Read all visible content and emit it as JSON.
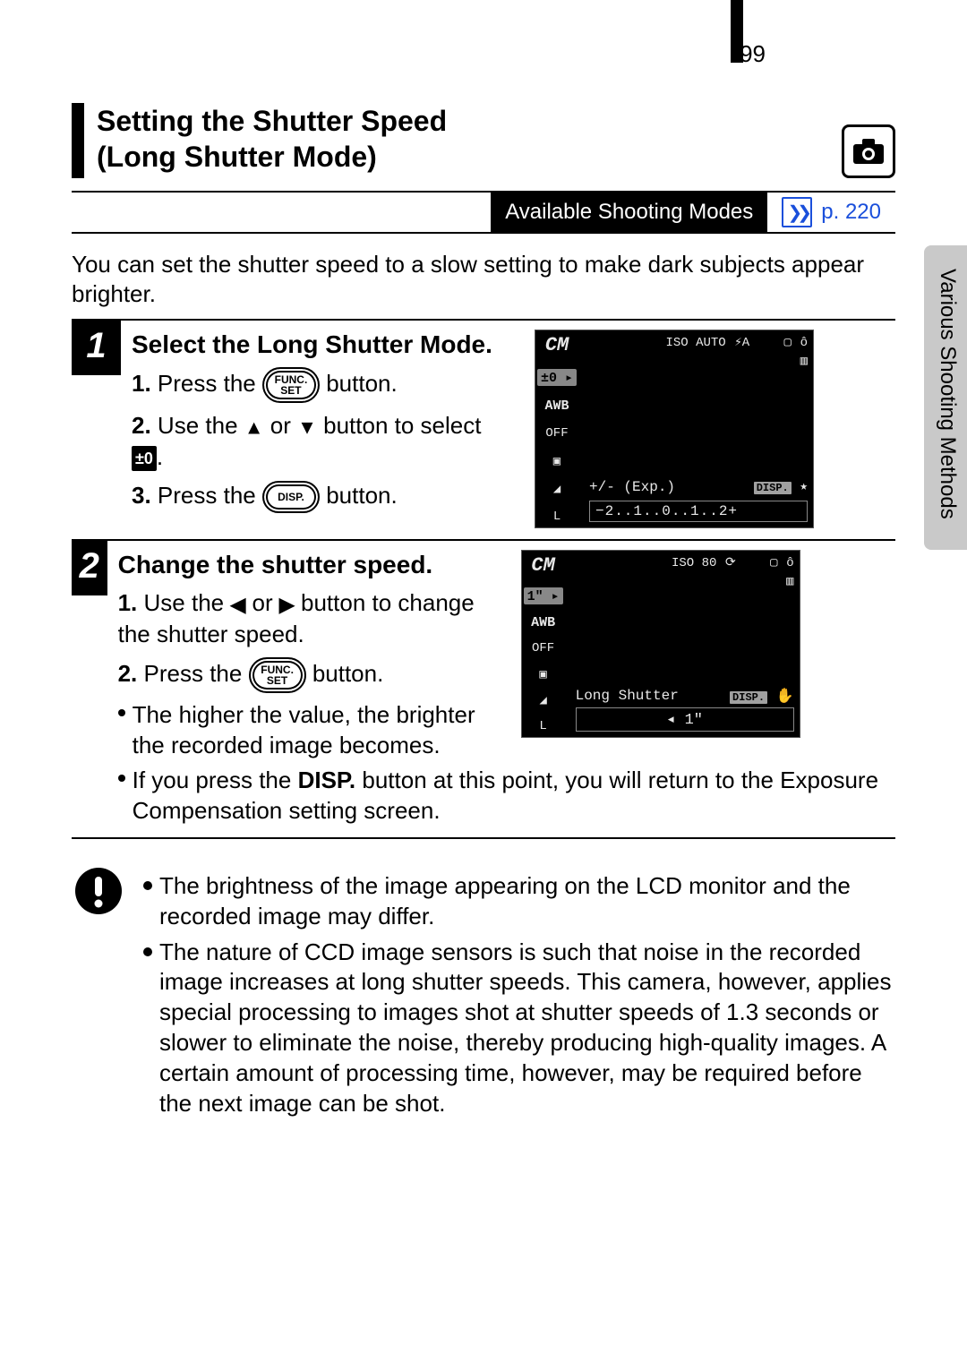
{
  "page_number": "99",
  "heading_line1": "Setting the Shutter Speed",
  "heading_line2": "(Long Shutter Mode)",
  "modes_label": "Available Shooting Modes",
  "modes_link": "p. 220",
  "intro_text": "You can set the shutter speed to a slow setting to make dark subjects appear brighter.",
  "side_label": "Various Shooting Methods",
  "step1": {
    "num": "1",
    "title": "Select the Long Shutter Mode.",
    "sub1_n": "1.",
    "sub1_a": "Press the ",
    "sub1_btn": "FUNC. SET",
    "sub1_b": " button.",
    "sub2_n": "2.",
    "sub2_a": "Use the ",
    "sub2_b": " or ",
    "sub2_c": " button to select ",
    "sub2_pm": "±0",
    "sub2_d": ".",
    "sub3_n": "3.",
    "sub3_a": "Press the ",
    "sub3_btn": "DISP.",
    "sub3_b": " button.",
    "lcd": {
      "cm": "CM",
      "pm": "±0 ▸",
      "awb": "AWB",
      "off": "OFF",
      "iso": "ISO AUTO",
      "flash": "⚡A",
      "frame": "▢",
      "timer": "ô",
      "batt": "▥",
      "L": "L",
      "exp_label": "+/- (Exp.)",
      "disp": "DISP.",
      "star": "⭑",
      "scale": "−2..1..0..1..2+"
    }
  },
  "step2": {
    "num": "2",
    "title": "Change the shutter speed.",
    "sub1_n": "1.",
    "sub1_a": "Use the ",
    "sub1_b": " or ",
    "sub1_c": " button to change the shutter speed.",
    "sub2_n": "2.",
    "sub2_a": "Press the ",
    "sub2_btn": "FUNC. SET",
    "sub2_b": " button.",
    "bullet1": "The higher the value, the brighter the recorded image becomes.",
    "bullet2a": "If you press the ",
    "bullet2b": "DISP.",
    "bullet2c": " button at this point, you will return to the Exposure Compensation setting screen.",
    "lcd": {
      "cm": "CM",
      "val": "1\" ▸",
      "awb": "AWB",
      "off": "OFF",
      "iso": "ISO 80",
      "timer2": "⟳",
      "frame": "▢",
      "timer": "ô",
      "batt": "▥",
      "caption": "Long Shutter",
      "disp": "DISP.",
      "hand": "✋",
      "value": "◂ 1\"",
      "L": "L"
    }
  },
  "warn": {
    "b1": "The brightness of the image appearing on the LCD monitor and the recorded image may differ.",
    "b2": "The nature of CCD image sensors is such that noise in the recorded image increases at long shutter speeds. This camera, however, applies special processing to images shot at shutter speeds of 1.3 seconds or slower to eliminate the noise, thereby producing high-quality images. A certain amount of processing time, however, may be required before the next image can be shot."
  }
}
